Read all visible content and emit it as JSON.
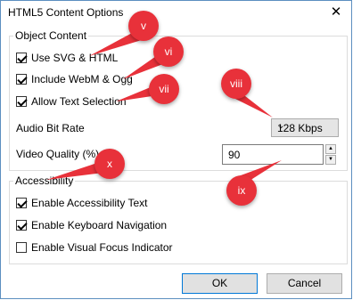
{
  "window": {
    "title": "HTML5 Content Options",
    "close_icon": "close-icon"
  },
  "object_content": {
    "label": "Object Content",
    "use_svg_html": {
      "label": "Use SVG & HTML",
      "checked": true
    },
    "include_webm_ogg": {
      "label": "Include WebM & Ogg",
      "checked": true
    },
    "allow_text_selection": {
      "label": "Allow Text Selection",
      "checked": true
    },
    "audio_bit_rate": {
      "label": "Audio Bit Rate",
      "value": "128 Kbps"
    },
    "video_quality": {
      "label": "Video Quality (%)",
      "value": "90"
    }
  },
  "accessibility": {
    "label": "Accessibility",
    "enable_accessibility_text": {
      "label": "Enable Accessibility Text",
      "checked": true
    },
    "enable_keyboard_navigation": {
      "label": "Enable Keyboard Navigation",
      "checked": true
    },
    "enable_visual_focus_indicator": {
      "label": "Enable Visual Focus Indicator",
      "checked": false
    }
  },
  "buttons": {
    "ok": "OK",
    "cancel": "Cancel"
  },
  "callouts": {
    "v": "v",
    "vi": "vi",
    "vii": "vii",
    "viii": "viii",
    "ix": "ix",
    "x": "x"
  },
  "colors": {
    "callout": "#e8313a"
  }
}
